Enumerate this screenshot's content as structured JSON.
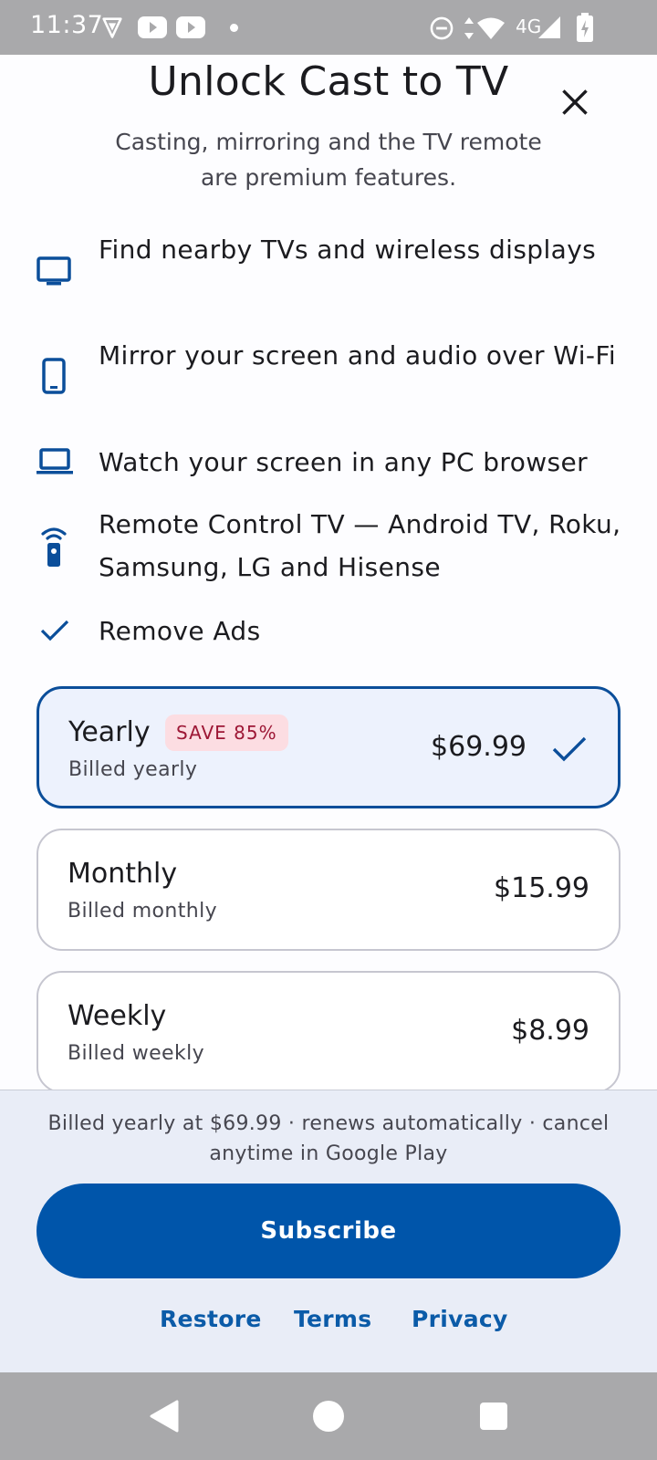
{
  "status_bar": {
    "time": "11:37",
    "network": "4G",
    "icons": [
      "vpn-shield-icon",
      "youtube-icon",
      "youtube-icon",
      "dnd-icon",
      "data-arrows-icon",
      "wifi-icon",
      "signal-icon",
      "battery-charging-icon"
    ]
  },
  "header": {
    "title": "Unlock Cast to TV",
    "subtitle": "Casting, mirroring and the TV remote are premium features."
  },
  "features": [
    {
      "icon": "tv-icon",
      "text": "Find nearby TVs and wireless displays"
    },
    {
      "icon": "phone-icon",
      "text": "Mirror your screen and audio over Wi-Fi"
    },
    {
      "icon": "laptop-icon",
      "text": "Watch your screen in any PC browser"
    },
    {
      "icon": "remote-icon",
      "text": "Remote Control TV — Android TV, Roku, Samsung, LG and Hisense"
    },
    {
      "icon": "check-icon",
      "text": "Remove Ads"
    }
  ],
  "plans": [
    {
      "name": "Yearly",
      "badge": "SAVE 85%",
      "sub": "Billed yearly",
      "price": "$69.99",
      "selected": true
    },
    {
      "name": "Monthly",
      "sub": "Billed monthly",
      "price": "$15.99",
      "selected": false
    },
    {
      "name": "Weekly",
      "sub": "Billed weekly",
      "price": "$8.99",
      "selected": false
    }
  ],
  "bottom": {
    "renew_note": "Billed yearly at $69.99 · renews automatically · cancel anytime in Google Play",
    "subscribe_label": "Subscribe",
    "links": {
      "restore": "Restore",
      "terms": "Terms",
      "privacy": "Privacy"
    }
  },
  "colors": {
    "accent": "#0055aa",
    "selected_border": "#0b4e9a",
    "selected_bg": "#edf2fd",
    "badge_bg": "#fcdde2",
    "badge_text": "#9d1735",
    "sheet_bg": "#e9edf7",
    "system_bar": "#a9a9ab"
  },
  "nav_bar": {
    "icons": [
      "back-icon",
      "home-icon",
      "recents-icon"
    ]
  }
}
